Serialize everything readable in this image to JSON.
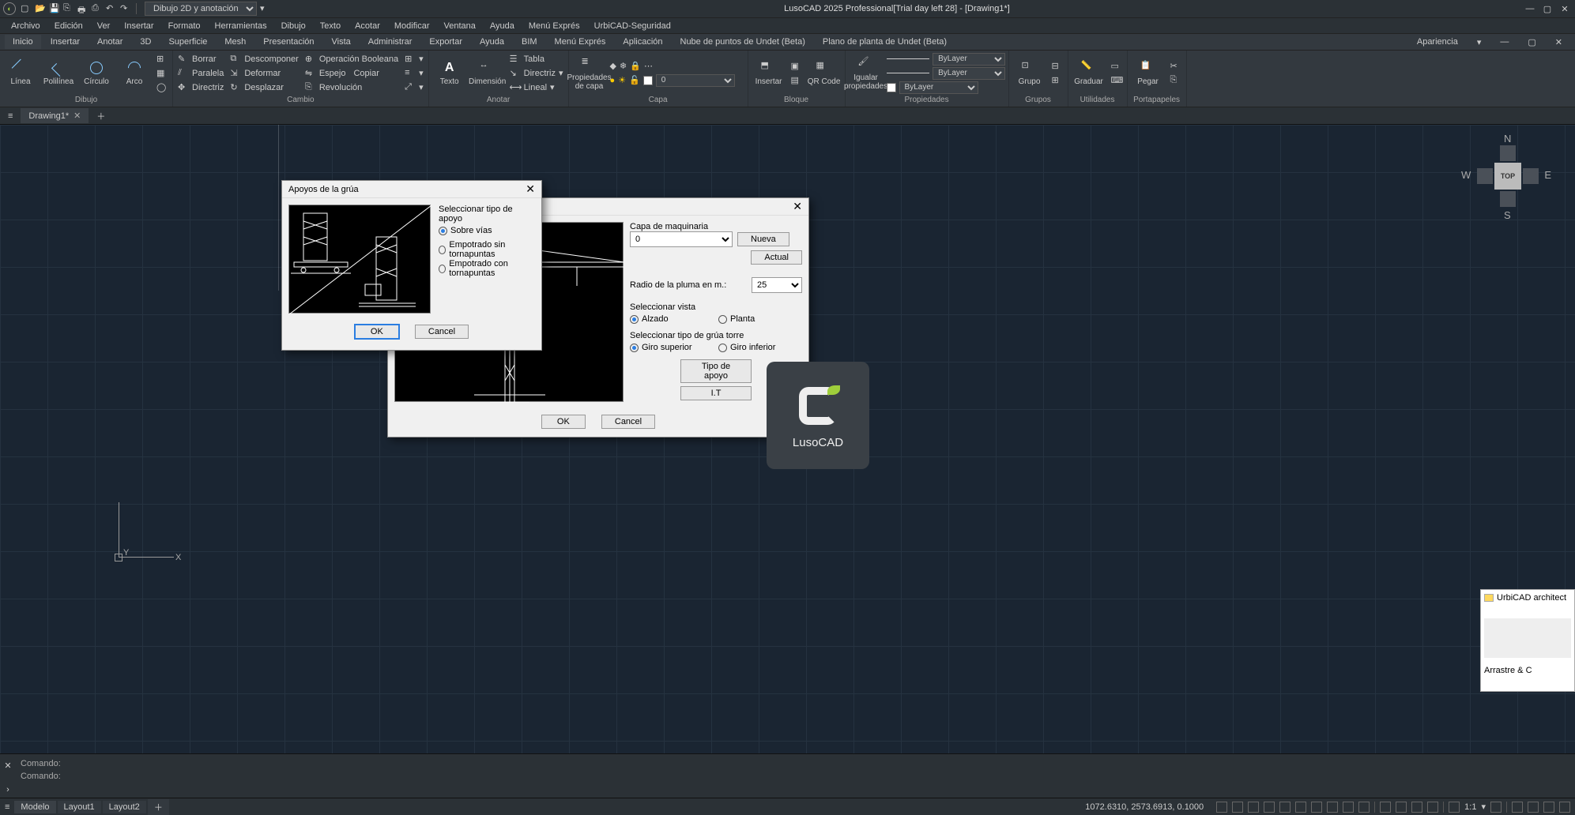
{
  "titlebar": {
    "workspace": "Dibujo 2D y anotación",
    "title": "LusoCAD 2025 Professional[Trial day left 28] - [Drawing1*]"
  },
  "menubar": [
    "Archivo",
    "Edición",
    "Ver",
    "Insertar",
    "Formato",
    "Herramientas",
    "Dibujo",
    "Texto",
    "Acotar",
    "Modificar",
    "Ventana",
    "Ayuda",
    "Menú Exprés",
    "UrbiCAD-Seguridad"
  ],
  "ribbon_tabs": [
    "Inicio",
    "Insertar",
    "Anotar",
    "3D",
    "Superficie",
    "Mesh",
    "Presentación",
    "Vista",
    "Administrar",
    "Exportar",
    "Ayuda",
    "BIM",
    "Menú Exprés",
    "Aplicación",
    "Nube de puntos de Undet (Beta)",
    "Plano de planta de Undet (Beta)"
  ],
  "ribbon_right": "Apariencia",
  "panels": {
    "dibujo": {
      "title": "Dibujo",
      "items": [
        "Línea",
        "Polilínea",
        "Círculo",
        "Arco"
      ]
    },
    "cambio": {
      "title": "Cambio",
      "items": [
        "Borrar",
        "Descomponer",
        "Operación Booleana",
        "Paralela",
        "Deformar",
        "Espejo",
        "Directriz",
        "Desplazar",
        "Revolución",
        "Copiar"
      ]
    },
    "anotar": {
      "title": "Anotar",
      "items": [
        "Texto",
        "Dimensión",
        "Tabla",
        "Directriz",
        "Lineal"
      ]
    },
    "capa": {
      "title": "Capa",
      "items": [
        "Propiedades de capa"
      ],
      "layer": "0"
    },
    "bloque": {
      "title": "Bloque",
      "items": [
        "Insertar",
        "QR Code"
      ]
    },
    "propiedades": {
      "title": "Propiedades",
      "items": [
        "Igualar propiedades"
      ],
      "bylayer": "ByLayer"
    },
    "grupos": {
      "title": "Grupos",
      "items": [
        "Grupo"
      ]
    },
    "utilidades": {
      "title": "Utilidades",
      "items": [
        "Graduar"
      ]
    },
    "portapapeles": {
      "title": "Portapapeles",
      "items": [
        "Pegar"
      ]
    }
  },
  "doc_tab": "Drawing1*",
  "viewcube": {
    "top": "TOP",
    "n": "N",
    "s": "S",
    "e": "E",
    "w": "W"
  },
  "ucs": {
    "x": "X",
    "y": "Y"
  },
  "dialog1": {
    "title": "Apoyos de la grúa",
    "group_label": "Seleccionar tipo de apoyo",
    "opt1": "Sobre vías",
    "opt2": "Empotrado sin tornapuntas",
    "opt3": "Empotrado con tornapuntas",
    "ok": "OK",
    "cancel": "Cancel"
  },
  "dialog2": {
    "capa_label": "Capa de maquinaria",
    "capa_value": "0",
    "nueva": "Nueva",
    "actual": "Actual",
    "radio_label": "Radio de la pluma en m.:",
    "radio_value": "25",
    "vista_label": "Seleccionar vista",
    "vista_alzado": "Alzado",
    "vista_planta": "Planta",
    "tipo_label": "Seleccionar tipo de grúa torre",
    "tipo_sup": "Giro superior",
    "tipo_inf": "Giro inferior",
    "tipo_apoyo": "Tipo de apoyo",
    "it": "I.T",
    "ok": "OK",
    "cancel": "Cancel"
  },
  "luso": "LusoCAD",
  "urbi": {
    "title": "UrbiCAD architect",
    "foot": "Arrastre & C"
  },
  "cmd": {
    "prompt1": "Comando:",
    "prompt2": "Comando:"
  },
  "status": {
    "model": "Modelo",
    "layout1": "Layout1",
    "layout2": "Layout2",
    "coords": "1072.6310, 2573.6913, 0.1000",
    "scale": "1:1"
  }
}
